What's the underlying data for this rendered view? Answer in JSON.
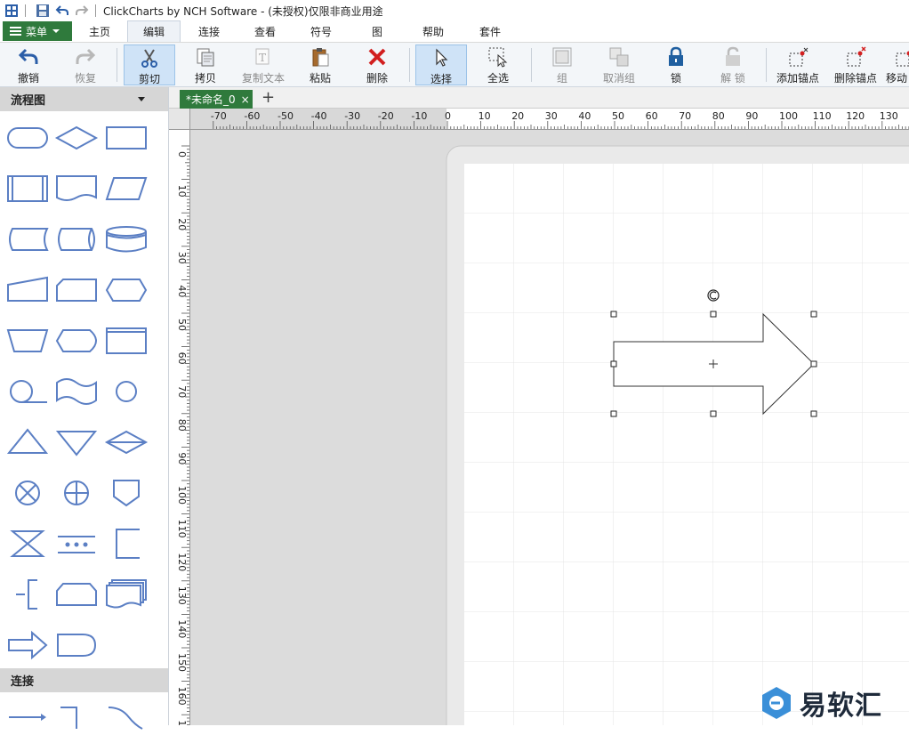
{
  "window": {
    "title": "ClickCharts by NCH Software - (未授权)仅限非商业用途"
  },
  "menubar": {
    "menu_label": "菜单",
    "tabs": [
      "主页",
      "编辑",
      "连接",
      "查看",
      "符号",
      "图",
      "帮助",
      "套件"
    ],
    "active_tab": "编辑"
  },
  "toolbar": {
    "undo": "撤销",
    "redo": "恢复",
    "cut": "剪切",
    "copy": "拷贝",
    "copy_text": "复制文本",
    "paste": "粘贴",
    "delete": "删除",
    "select": "选择",
    "select_all": "全选",
    "group": "组",
    "ungroup": "取消组",
    "lock": "锁",
    "unlock": "解 锁",
    "add_anchor": "添加锚点",
    "delete_anchor": "删除锚点",
    "move": "移动"
  },
  "sidebar": {
    "flowchart_title": "流程图",
    "connections_title": "连接",
    "shapes": [
      "terminator",
      "decision",
      "process",
      "predefined-process",
      "document",
      "data",
      "stored-data",
      "direct-access-storage",
      "database",
      "manual-input",
      "card",
      "preparation",
      "manual-operation",
      "display",
      "internal-storage",
      "sequential-access-storage",
      "punched-tape",
      "connector",
      "extract",
      "merge",
      "sort",
      "summing-junction",
      "or",
      "off-page-reference",
      "collate",
      "loop-limit",
      "annotation",
      "annotation-left",
      "punched-card",
      "multi-document",
      "arrow-right",
      "delay"
    ]
  },
  "document": {
    "tab_label": "*未命名_0",
    "close_icon": "×",
    "new_tab_icon": "+"
  },
  "rulers": {
    "h_labels": [
      "-70",
      "-60",
      "-50",
      "-40",
      "-30",
      "-20",
      "-10",
      "0",
      "10",
      "20",
      "30",
      "40",
      "50",
      "60",
      "70",
      "80",
      "90",
      "100",
      "110",
      "120",
      "130"
    ],
    "v_labels": [
      "0",
      "10",
      "20",
      "30",
      "40",
      "50",
      "60",
      "70",
      "80",
      "90",
      "100",
      "110",
      "120",
      "130",
      "140",
      "150",
      "160",
      "170"
    ]
  },
  "watermark": {
    "text": "易软汇"
  },
  "colors": {
    "accent_green": "#2f7a3c",
    "shape_blue": "#5b7fc4"
  }
}
